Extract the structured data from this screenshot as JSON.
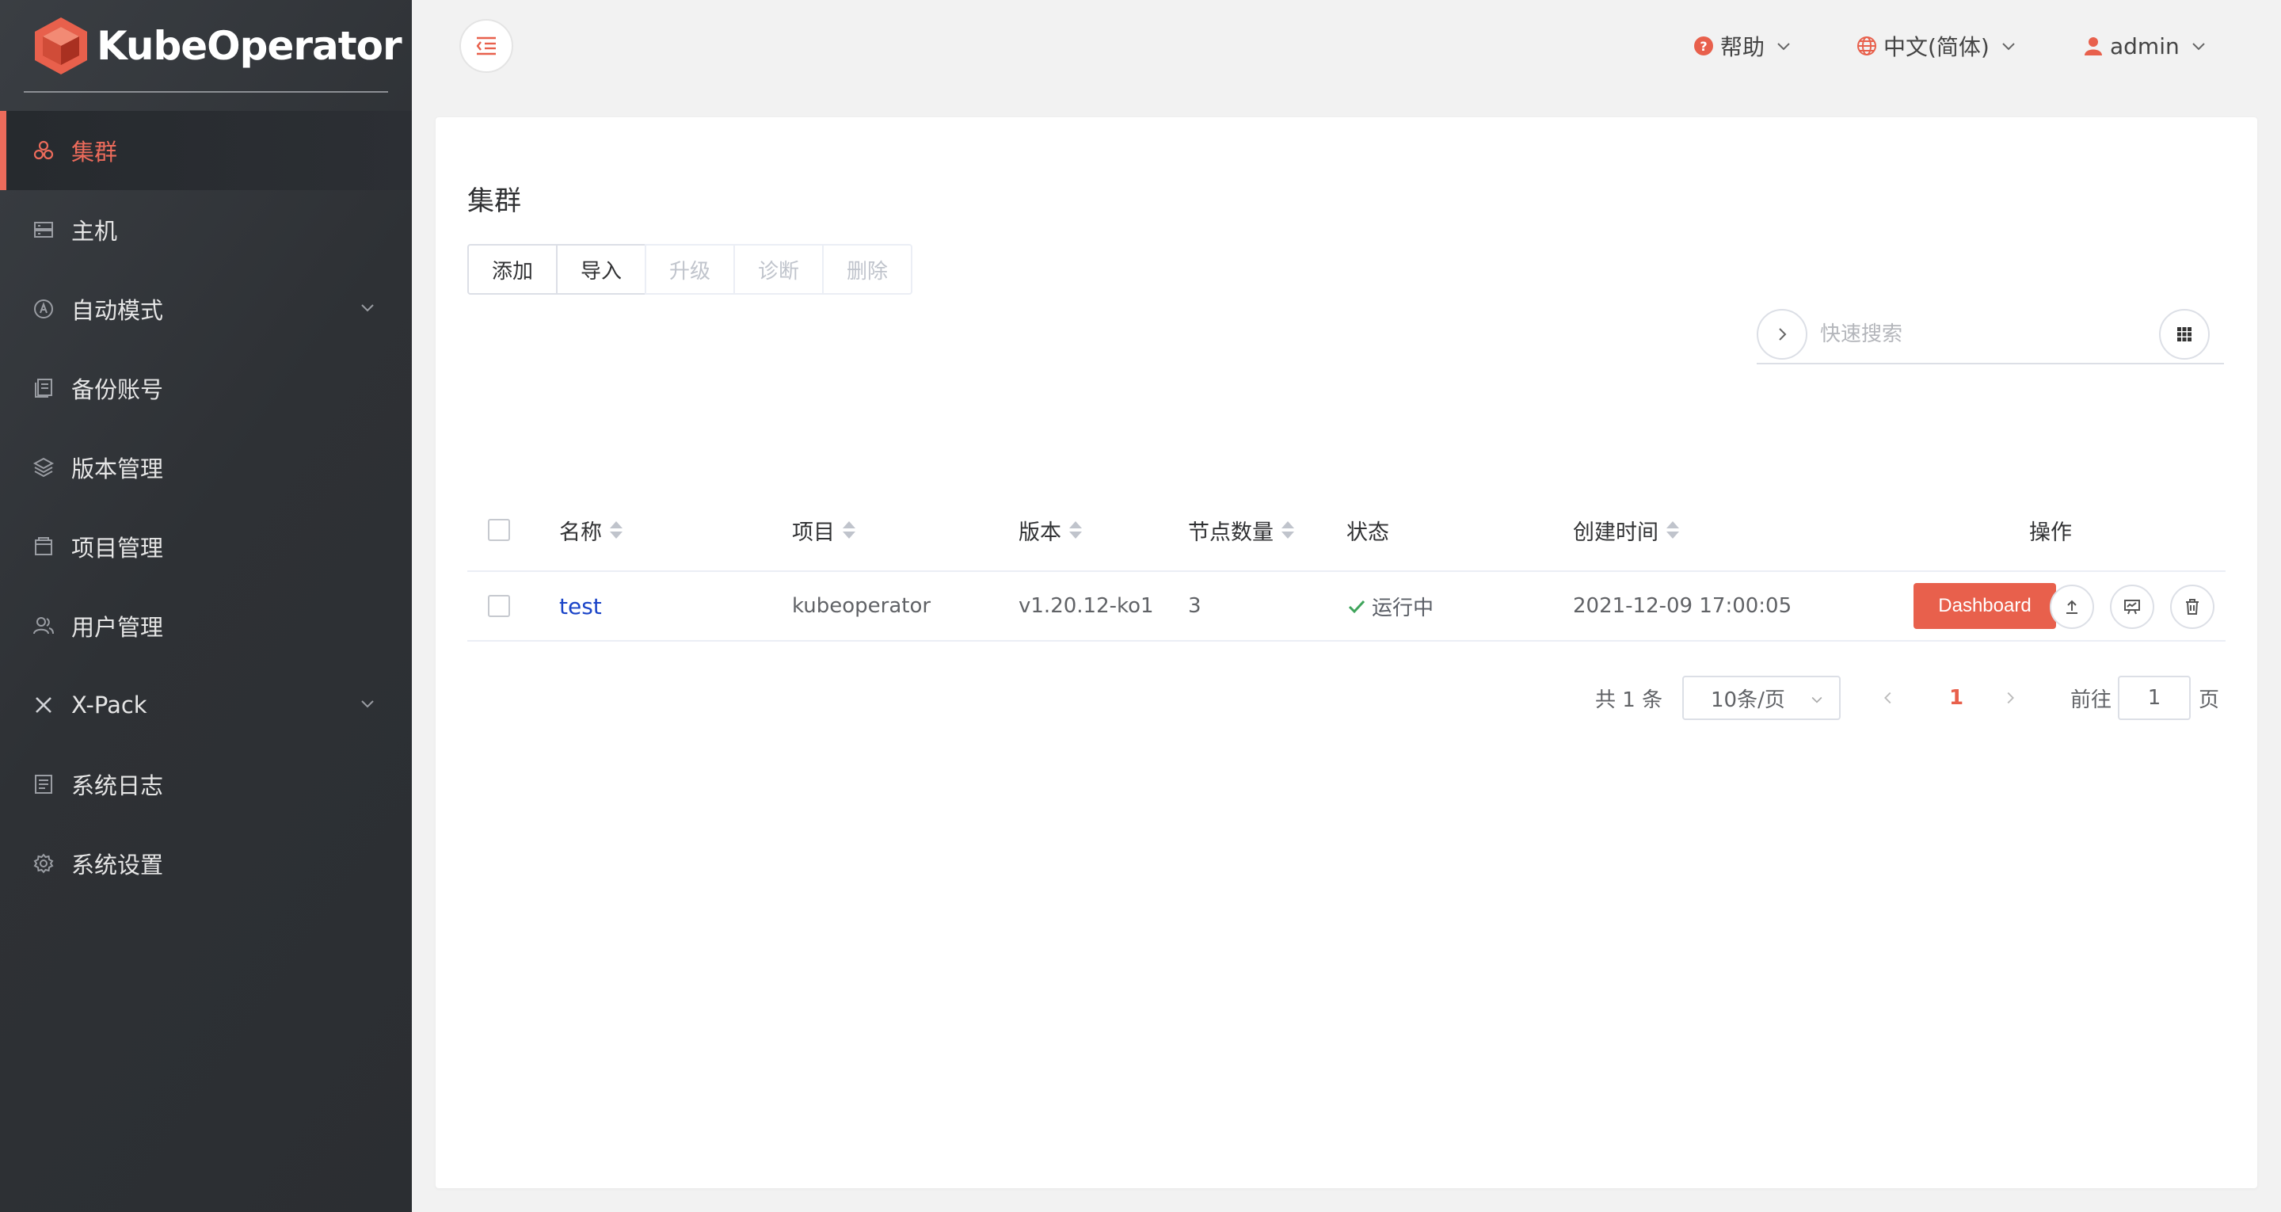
{
  "app": {
    "logo_text": "KubeOperator"
  },
  "sidebar": {
    "items": [
      {
        "label": "集群",
        "icon": "cluster-icon",
        "active": true
      },
      {
        "label": "主机",
        "icon": "host-icon"
      },
      {
        "label": "自动模式",
        "icon": "auto-mode-icon",
        "expandable": true
      },
      {
        "label": "备份账号",
        "icon": "backup-icon"
      },
      {
        "label": "版本管理",
        "icon": "version-icon"
      },
      {
        "label": "项目管理",
        "icon": "project-icon"
      },
      {
        "label": "用户管理",
        "icon": "user-icon"
      },
      {
        "label": "X-Pack",
        "icon": "xpack-icon",
        "expandable": true
      },
      {
        "label": "系统日志",
        "icon": "log-icon"
      },
      {
        "label": "系统设置",
        "icon": "settings-icon"
      }
    ]
  },
  "header": {
    "help_label": "帮助",
    "language_label": "中文(简体)",
    "user_label": "admin"
  },
  "main": {
    "title": "集群",
    "toolbar": {
      "add": "添加",
      "import": "导入",
      "upgrade": "升级",
      "diagnose": "诊断",
      "delete": "删除"
    },
    "search": {
      "placeholder": "快速搜索",
      "value": ""
    },
    "table": {
      "columns": [
        "名称",
        "项目",
        "版本",
        "节点数量",
        "状态",
        "创建时间",
        "操作"
      ],
      "rows": [
        {
          "name": "test",
          "project": "kubeoperator",
          "version": "v1.20.12-ko1",
          "nodes": "3",
          "status": "运行中",
          "created": "2021-12-09 17:00:05",
          "dashboard": "Dashboard"
        }
      ]
    },
    "pagination": {
      "total": "共 1 条",
      "page_size": "10条/页",
      "current_page": "1",
      "goto_label": "前往",
      "goto_value": "1",
      "page_suffix": "页"
    }
  },
  "colors": {
    "accent": "#e8604c",
    "sidebar_bg": "#2f3237",
    "link": "#1a44c8",
    "success": "#3fa45b"
  }
}
